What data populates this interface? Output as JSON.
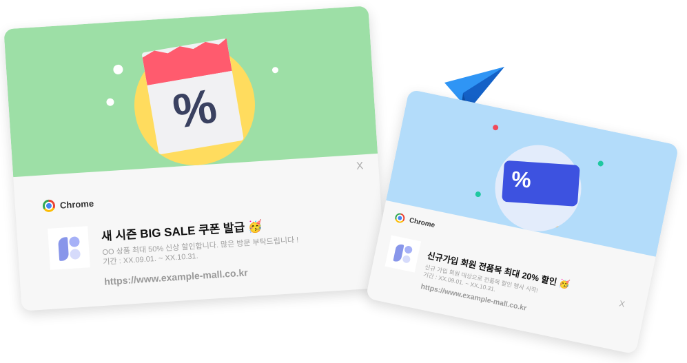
{
  "notifications": [
    {
      "app_name": "Chrome",
      "title": "새 시즌 BIG SALE 쿠폰  발급",
      "emoji": "🥳",
      "description_line1": "OO 상품 최대 50% 신상 할인합니다. 많은 방문 부탁드립니다 !",
      "description_line2": "기간 : XX.09.01. ~ XX.10.31.",
      "url": "https://www.example-mall.co.kr",
      "close_label": "X",
      "hero_symbol": "%",
      "hero_color": "#9ddfa6"
    },
    {
      "app_name": "Chrome",
      "title": "신규가입 회원 전품목 최대 20% 할인",
      "emoji": "🥳",
      "description_line1": "신규 가입 회원 대상으로 전품목 할인 행사 시작!",
      "description_line2": "기간 : XX.09.01. ~ XX.10.31.",
      "url": "https://www.example-mall.co.kr",
      "close_label": "X",
      "hero_symbol": "%",
      "hero_color": "#b3dcfa"
    }
  ]
}
